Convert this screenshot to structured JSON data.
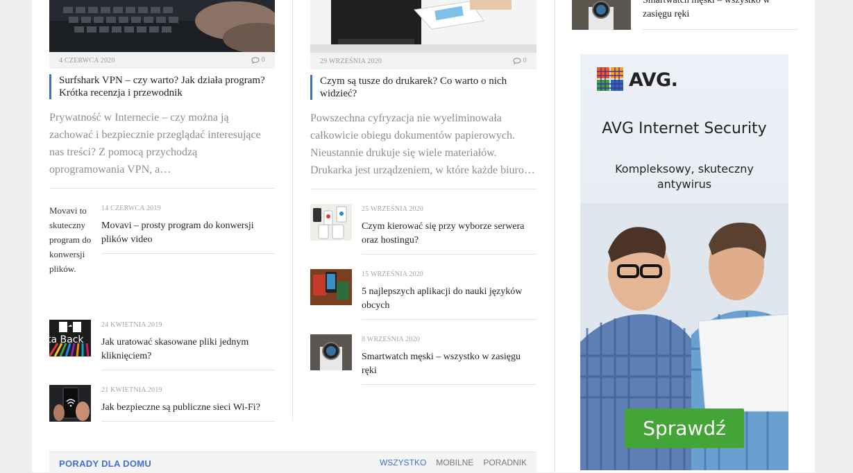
{
  "featured": [
    {
      "date": "4 czerwca 2020",
      "comments": "0",
      "title": "Surfshark VPN – czy warto? Jak działa program? Krótka recenzja i przewodnik",
      "excerpt": "Prywatność w Internecie – czy można ją zachować i bezpiecznie przeglądać interesujące nas treści? Z pomocą przychodzą oprogramowania VPN, a…"
    },
    {
      "date": "29 września 2020",
      "comments": "0",
      "title": "Czym są tusze do drukarek? Co warto o nich widzieć?",
      "excerpt": "Powszechna cyfryzacja nie wyeliminowała całkowicie obiegu dokumentów papierowych. Nieustannie drukuje się wiele materiałów. Drukarka jest urządzeniem, w które każde biuro…"
    }
  ],
  "list_left": [
    {
      "date": "14 czerwca 2019",
      "title": "Movavi – prosty program do konwersji plików video",
      "thumb_alt": "Movavi to skuteczny program do konwersji plików."
    },
    {
      "date": "24 kwietnia 2019",
      "title": "Jak uratować skasowane pliki jednym kliknięciem?",
      "thumb_text": "ta Back"
    },
    {
      "date": "21 kwietnia 2019",
      "title": "Jak bezpieczne są publiczne sieci Wi-Fi?"
    }
  ],
  "list_right": [
    {
      "date": "25 września 2020",
      "title": "Czym kierować się przy wyborze serwera oraz hostingu?"
    },
    {
      "date": "15 września 2020",
      "title": "5 najlepszych aplikacji do nauki języków obcych"
    },
    {
      "date": "8 września 2020",
      "title": "Smartwatch męski – wszystko w zasięgu ręki"
    }
  ],
  "sidebar_top": {
    "title": "Smartwatch męski – wszystko w zasięgu ręki"
  },
  "category": {
    "title": "PORADY DLA DOMU",
    "tabs": [
      "WSZYSTKO",
      "MOBILNE",
      "PORADNIK"
    ],
    "active_tab": "WSZYSTKO"
  },
  "ad": {
    "brand": "AVG.",
    "title": "AVG Internet Security",
    "subtitle": "Kompleksowy, skuteczny antywirus",
    "button": "Sprawdź"
  },
  "colors": {
    "accent": "#3f6fd1",
    "ad_button": "#43a535"
  }
}
